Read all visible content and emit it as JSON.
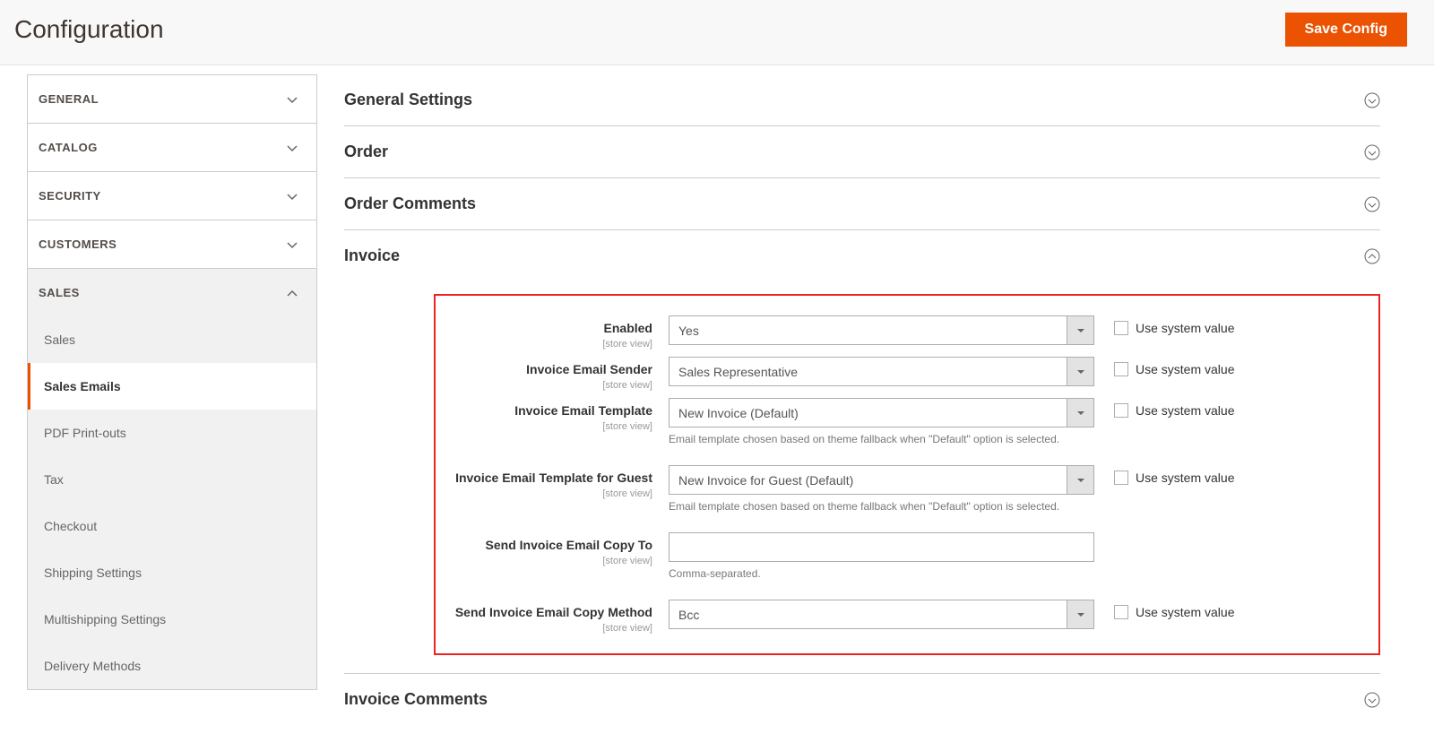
{
  "header": {
    "title": "Configuration",
    "save_label": "Save Config"
  },
  "sidebar": {
    "sections": [
      {
        "label": "General",
        "expanded": false
      },
      {
        "label": "Catalog",
        "expanded": false
      },
      {
        "label": "Security",
        "expanded": false
      },
      {
        "label": "Customers",
        "expanded": false
      },
      {
        "label": "Sales",
        "expanded": true
      }
    ],
    "sales_items": [
      {
        "label": "Sales",
        "active": false
      },
      {
        "label": "Sales Emails",
        "active": true
      },
      {
        "label": "PDF Print-outs",
        "active": false
      },
      {
        "label": "Tax",
        "active": false
      },
      {
        "label": "Checkout",
        "active": false
      },
      {
        "label": "Shipping Settings",
        "active": false
      },
      {
        "label": "Multishipping Settings",
        "active": false
      },
      {
        "label": "Delivery Methods",
        "active": false
      }
    ]
  },
  "groups": {
    "general_settings": "General Settings",
    "order": "Order",
    "order_comments": "Order Comments",
    "invoice": "Invoice",
    "invoice_comments": "Invoice Comments"
  },
  "invoice_fields": {
    "scope_text": "[store view]",
    "use_system_label": "Use system value",
    "enabled": {
      "label": "Enabled",
      "value": "Yes"
    },
    "sender": {
      "label": "Invoice Email Sender",
      "value": "Sales Representative"
    },
    "template": {
      "label": "Invoice Email Template",
      "value": "New Invoice (Default)",
      "note": "Email template chosen based on theme fallback when \"Default\" option is selected."
    },
    "guest_template": {
      "label": "Invoice Email Template for Guest",
      "value": "New Invoice for Guest (Default)",
      "note": "Email template chosen based on theme fallback when \"Default\" option is selected."
    },
    "copy_to": {
      "label": "Send Invoice Email Copy To",
      "value": "",
      "note": "Comma-separated."
    },
    "copy_method": {
      "label": "Send Invoice Email Copy Method",
      "value": "Bcc"
    }
  }
}
